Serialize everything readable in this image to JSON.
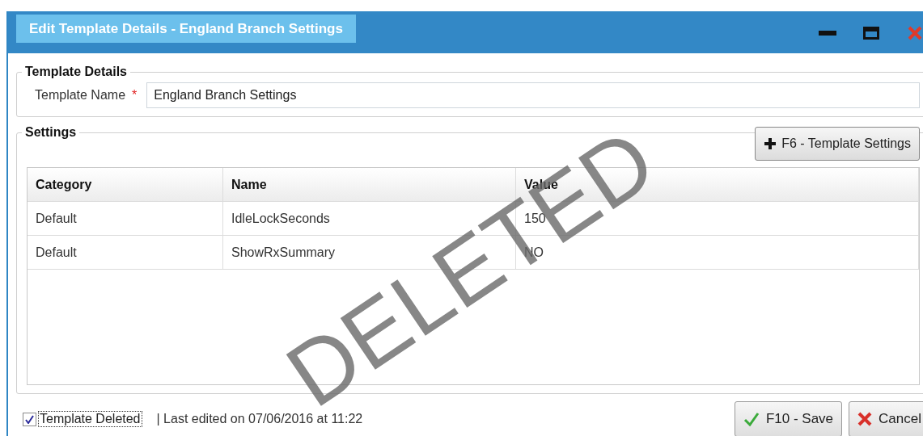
{
  "window": {
    "title": "Edit Template Details - England Branch Settings",
    "controls": [
      {
        "kind": "minimize"
      },
      {
        "kind": "maximize"
      },
      {
        "kind": "close"
      }
    ]
  },
  "template_details": {
    "legend": "Template Details",
    "field_label": "Template Name",
    "required_mark": "*",
    "value": "England Branch Settings"
  },
  "settings": {
    "legend": "Settings",
    "add_button": "F6 - Template Settings",
    "table": {
      "columns": [
        "Category",
        "Name",
        "Value"
      ],
      "rows": [
        {
          "cells": [
            "Default",
            "IdleLockSeconds",
            "150"
          ]
        },
        {
          "cells": [
            "Default",
            "ShowRxSummary",
            "NO"
          ]
        }
      ]
    }
  },
  "stamp": "DELETED",
  "footer": {
    "checkbox": {
      "label": "Template Deleted",
      "checked": true
    },
    "last_edited": "| Last edited on 07/06/2016 at 11:22",
    "buttons": [
      {
        "kind": "save",
        "label": "F10 - Save"
      },
      {
        "kind": "cancel",
        "label": "Cancel"
      }
    ]
  }
}
